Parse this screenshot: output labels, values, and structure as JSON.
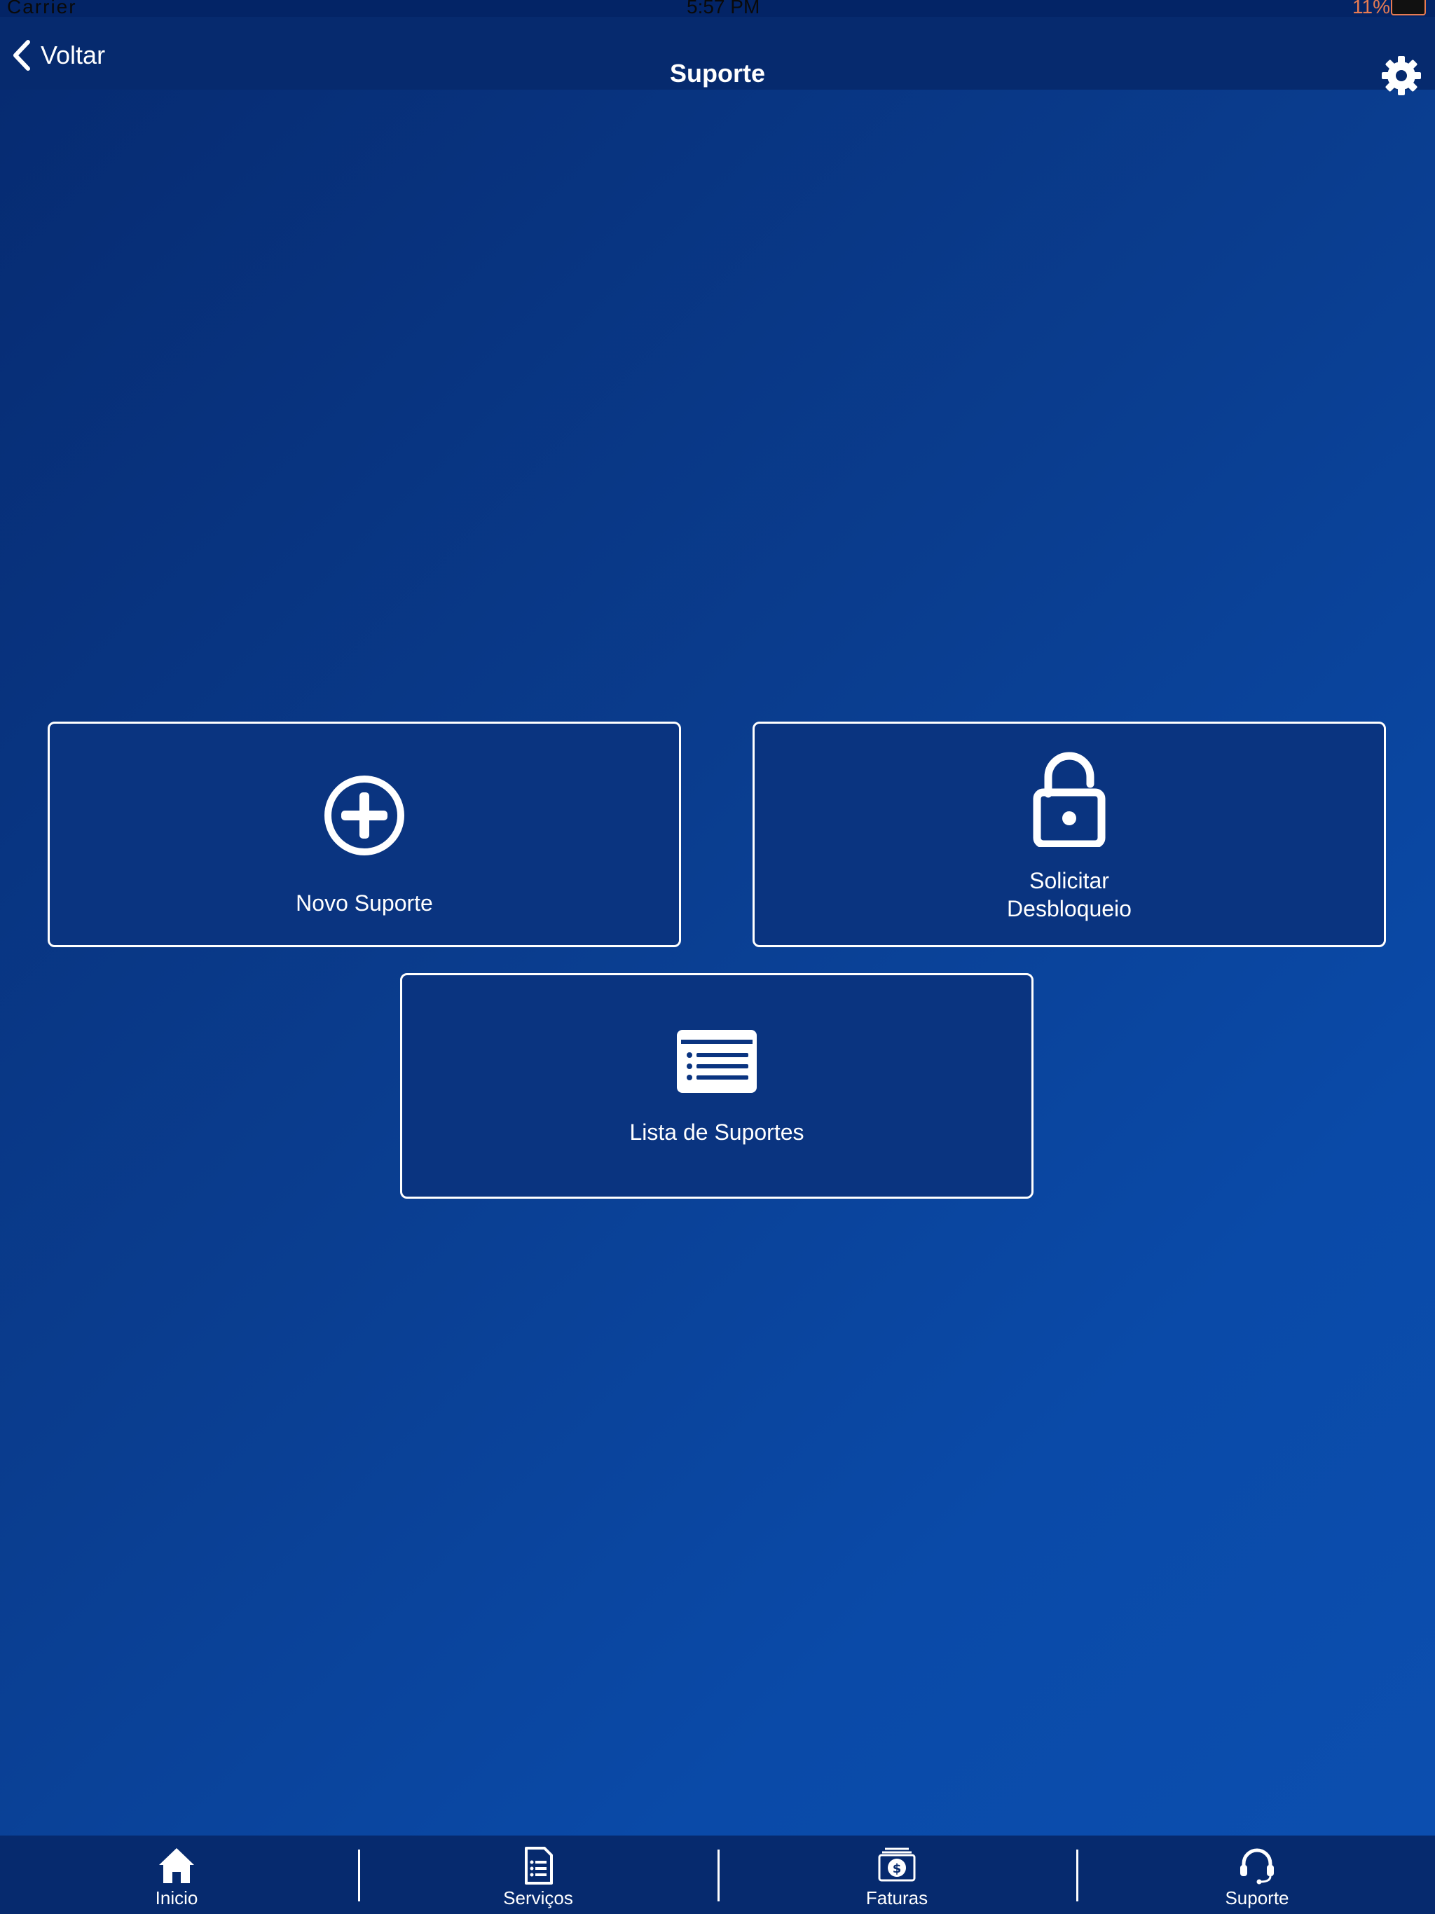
{
  "status_bar": {
    "carrier": "Carrier",
    "time": "5:57 PM",
    "battery": "11%"
  },
  "nav": {
    "back_label": "Voltar",
    "title": "Suporte"
  },
  "cards": {
    "novo_suporte": "Novo Suporte",
    "solicitar_line1": "Solicitar",
    "solicitar_line2": "Desbloqueio",
    "lista_suportes": "Lista de Suportes"
  },
  "tabs": [
    {
      "label": "Inicio",
      "icon": "home-icon"
    },
    {
      "label": "Serviços",
      "icon": "document-list-icon"
    },
    {
      "label": "Faturas",
      "icon": "money-stack-icon"
    },
    {
      "label": "Suporte",
      "icon": "headset-icon"
    }
  ],
  "colors": {
    "nav_background": "#062a6e",
    "card_background": "#0a3480",
    "accent_white": "#ffffff"
  }
}
